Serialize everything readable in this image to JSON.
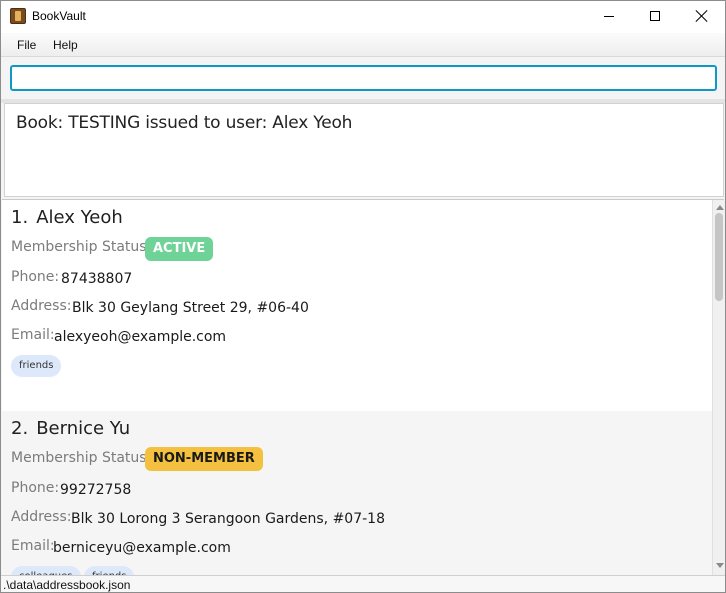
{
  "window": {
    "title": "BookVault",
    "icon": "book-app-icon",
    "controls": [
      "minimize-icon",
      "maximize-icon",
      "close-icon"
    ]
  },
  "menu": {
    "file": "File",
    "help": "Help"
  },
  "command": {
    "value": "",
    "placeholder": ""
  },
  "result": {
    "message": "Book: TESTING issued to user: Alex Yeoh"
  },
  "labels": {
    "membership": "Membership Status:",
    "phone": "Phone:",
    "address": "Address:",
    "email": "Email:"
  },
  "persons": [
    {
      "index": "1.",
      "name": "Alex Yeoh",
      "status": "ACTIVE",
      "phone": "87438807",
      "address": "Blk 30 Geylang Street 29, #06-40",
      "email": "alexyeoh@example.com",
      "tags": [
        "friends"
      ]
    },
    {
      "index": "2.",
      "name": "Bernice Yu",
      "status": "NON-MEMBER",
      "phone": "99272758",
      "address": "Blk 30 Lorong 3 Serangoon Gardens, #07-18",
      "email": "berniceyu@example.com",
      "tags": [
        "colleagues",
        "friends"
      ]
    }
  ],
  "colors": {
    "accent": "#0e98c8",
    "active": "#6fd296",
    "non_member": "#f3c13f",
    "tag": "#dde8fa"
  },
  "status_bar": {
    "path": ".\\data\\addressbook.json"
  }
}
